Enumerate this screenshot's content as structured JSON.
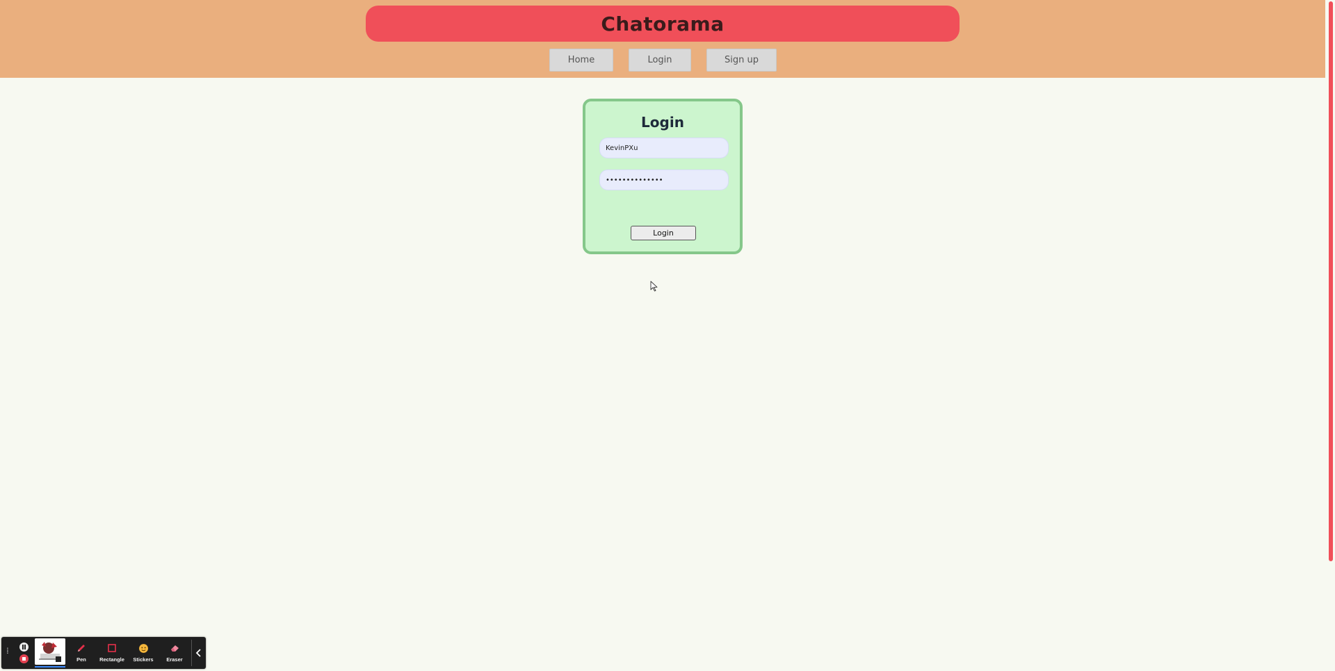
{
  "header": {
    "brand": "Chatorama",
    "nav": [
      {
        "label": "Home"
      },
      {
        "label": "Login"
      },
      {
        "label": "Sign up"
      }
    ]
  },
  "login": {
    "title": "Login",
    "username_value": "KevinPXu",
    "password_value": "••••••••••••••",
    "submit_label": "Login"
  },
  "recording_toolbar": {
    "tools": [
      {
        "label": "Pen",
        "icon": "pen-icon"
      },
      {
        "label": "Rectangle",
        "icon": "rectangle-icon"
      },
      {
        "label": "Stickers",
        "icon": "sticker-icon"
      },
      {
        "label": "Eraser",
        "icon": "eraser-icon"
      }
    ]
  },
  "colors": {
    "header_bg": "#eaaf7e",
    "brand_banner": "#f04f59",
    "page_bg": "#f7f9f1",
    "card_bg": "#ccf5ce",
    "card_border": "#85c78a",
    "scroll_thumb": "#f04f59"
  }
}
